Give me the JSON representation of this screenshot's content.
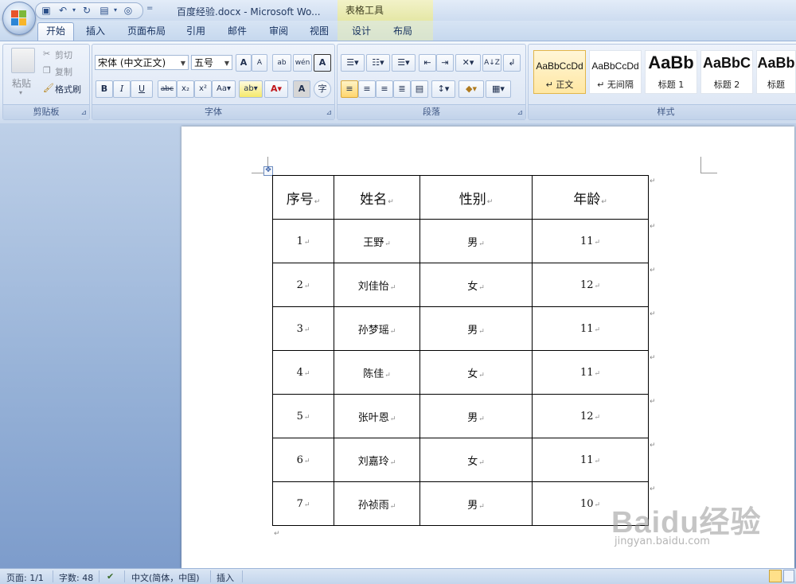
{
  "window": {
    "title": "百度经验.docx - Microsoft Wo...",
    "contextual_caption": "表格工具"
  },
  "qat": {
    "icons": [
      "save-icon",
      "undo-icon",
      "redo-icon",
      "new-doc-icon",
      "print-preview-icon"
    ],
    "more": "="
  },
  "tabs": [
    {
      "label": "开始",
      "active": true
    },
    {
      "label": "插入"
    },
    {
      "label": "页面布局"
    },
    {
      "label": "引用"
    },
    {
      "label": "邮件"
    },
    {
      "label": "审阅"
    },
    {
      "label": "视图"
    },
    {
      "label": "设计"
    },
    {
      "label": "布局"
    }
  ],
  "ribbon": {
    "clipboard": {
      "label": "剪贴板",
      "paste": "粘贴",
      "cut": "剪切",
      "copy": "复制",
      "format_painter": "格式刷"
    },
    "font": {
      "label": "字体",
      "font_name": "宋体 (中文正文)",
      "font_size": "五号"
    },
    "paragraph": {
      "label": "段落"
    },
    "styles": {
      "label": "样式",
      "items": [
        {
          "sample": "AaBbCcDd",
          "name": "↵ 正文",
          "selected": true
        },
        {
          "sample": "AaBbCcDd",
          "name": "↵ 无间隔"
        },
        {
          "sample": "AaBb",
          "name": "标题 1"
        },
        {
          "sample": "AaBbC",
          "name": "标题 2"
        },
        {
          "sample": "AaBb",
          "name": "标题"
        }
      ]
    }
  },
  "table": {
    "headers": [
      "序号",
      "姓名",
      "性别",
      "年龄"
    ],
    "rows": [
      [
        "1",
        "王野",
        "男",
        "11"
      ],
      [
        "2",
        "刘佳怡",
        "女",
        "12"
      ],
      [
        "3",
        "孙梦瑶",
        "男",
        "11"
      ],
      [
        "4",
        "陈佳",
        "女",
        "11"
      ],
      [
        "5",
        "张叶恩",
        "男",
        "12"
      ],
      [
        "6",
        "刘嘉玲",
        "女",
        "11"
      ],
      [
        "7",
        "孙祯雨",
        "男",
        "10"
      ]
    ]
  },
  "watermark": {
    "text": "Baidu经验",
    "url": "jingyan.baidu.com"
  },
  "statusbar": {
    "page": "页面: 1/1",
    "words": "字数: 48",
    "language": "中文(简体，中国)",
    "mode": "插入"
  }
}
